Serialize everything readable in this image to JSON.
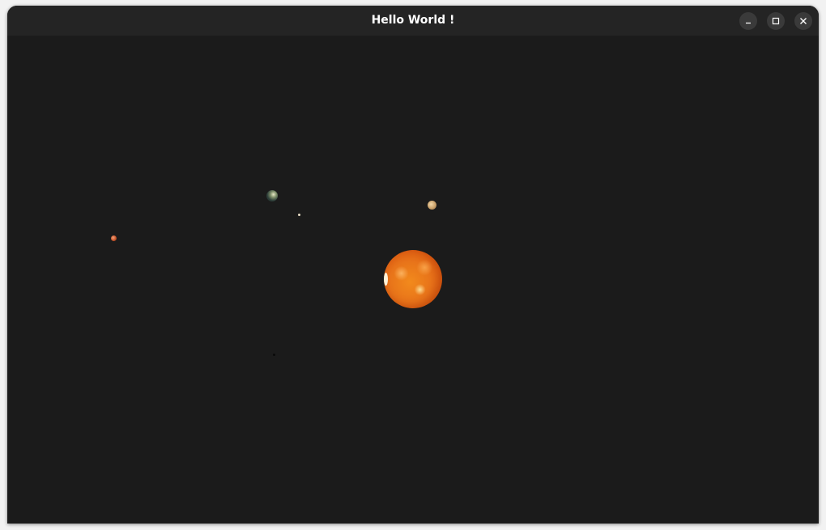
{
  "window": {
    "title": "Hello World !"
  },
  "titlebar_buttons": {
    "minimize": "minimize-icon",
    "maximize": "maximize-icon",
    "close": "close-icon"
  },
  "colors": {
    "background": "#1b1b1b",
    "titlebar": "#242424",
    "title_text": "#ffffff",
    "sun": "#e8741a"
  }
}
